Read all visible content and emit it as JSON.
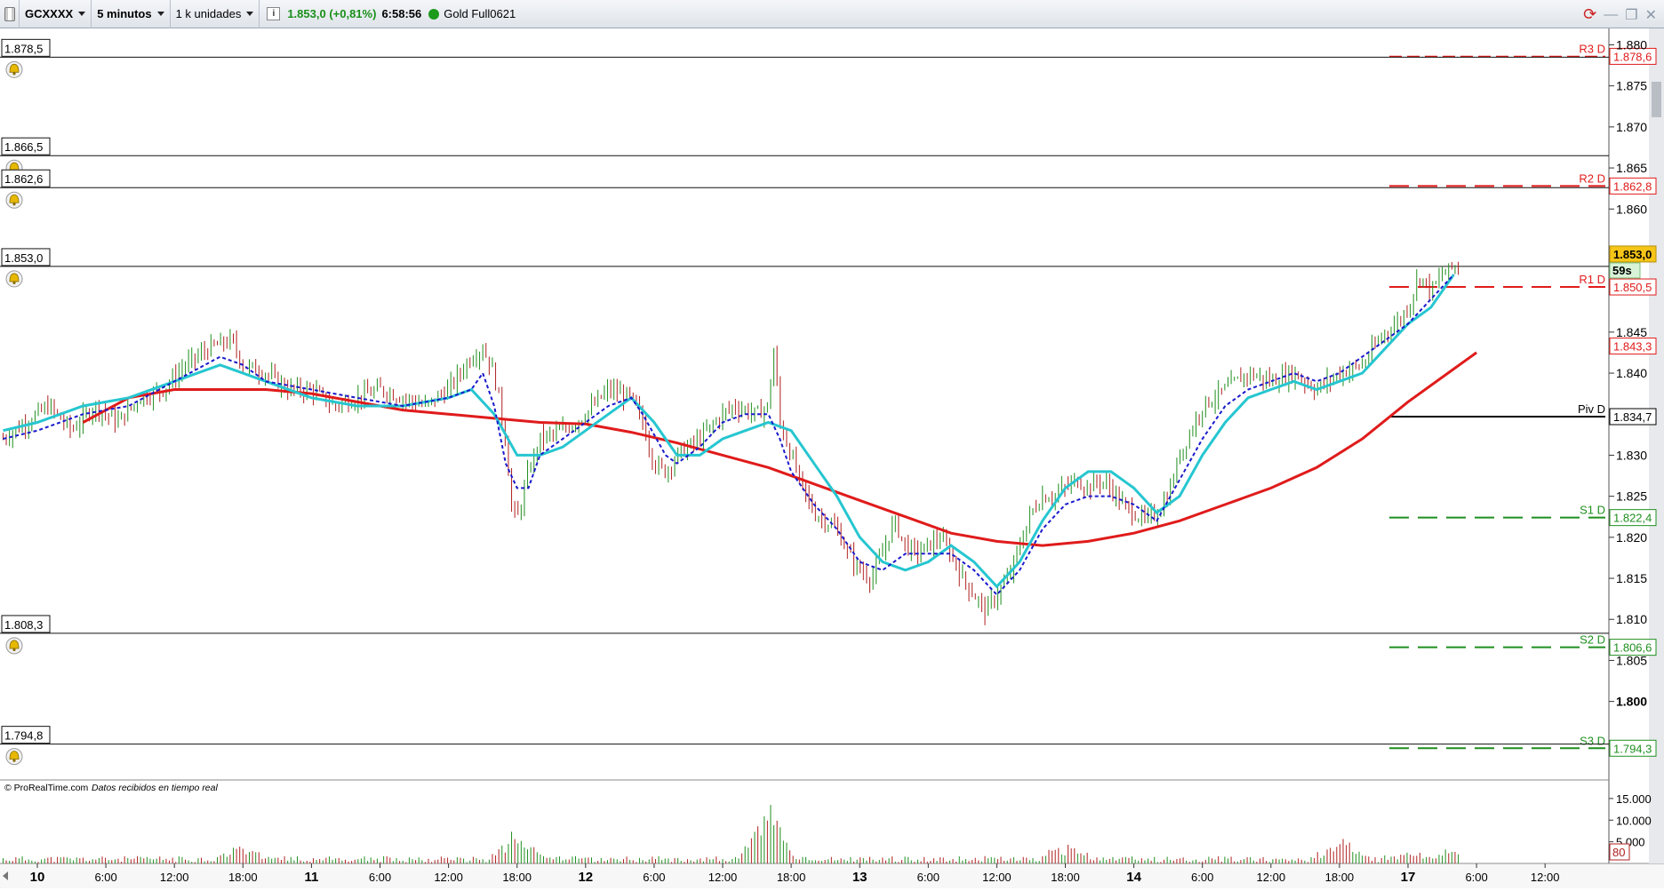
{
  "toolbar": {
    "symbol": "GCXXXX",
    "timeframe": "5 minutos",
    "units": "1 k unidades",
    "info_icon": "info-icon",
    "price_change": "1.853,0 (+0,81%)",
    "time": "6:58:56",
    "status_color": "#1c9a1c",
    "instrument": "Gold Full0621"
  },
  "colors": {
    "price_up": "#1f8f1f",
    "price_down": "#b02020",
    "ma_slow": "#e01b1b",
    "ma_fast": "#26c6d0",
    "ma_dashed": "#1a1acc",
    "resistance": "#e01b1b",
    "support": "#1f8f1f",
    "pivot": "#000000",
    "current_price_bg": "#f5c518"
  },
  "watermark": {
    "brand": "© ProRealTime.com",
    "feed": "Datos recibidos en tiempo real"
  },
  "alert_lines": [
    {
      "value": 1878.5,
      "label": "1.878,5"
    },
    {
      "value": 1866.5,
      "label": "1.866,5"
    },
    {
      "value": 1862.6,
      "label": "1.862,6"
    },
    {
      "value": 1853.0,
      "label": "1.853,0"
    },
    {
      "value": 1808.3,
      "label": "1.808,3"
    },
    {
      "value": 1794.8,
      "label": "1.794,8"
    }
  ],
  "pivot_levels": [
    {
      "name": "R3 D",
      "value": 1878.6,
      "label": "1.878,6",
      "kind": "resistance"
    },
    {
      "name": "R2 D",
      "value": 1862.8,
      "label": "1.862,8",
      "kind": "resistance"
    },
    {
      "name": "R1 D",
      "value": 1850.5,
      "label": "1.850,5",
      "kind": "resistance"
    },
    {
      "name": "Piv D",
      "value": 1834.7,
      "label": "1.834,7",
      "kind": "pivot"
    },
    {
      "name": "S1 D",
      "value": 1822.4,
      "label": "1.822,4",
      "kind": "support"
    },
    {
      "name": "S2 D",
      "value": 1806.6,
      "label": "1.806,6",
      "kind": "support"
    },
    {
      "name": "S3 D",
      "value": 1794.3,
      "label": "1.794,3",
      "kind": "support"
    }
  ],
  "price_markers": {
    "current": {
      "value": 1853.0,
      "label": "1.853,0"
    },
    "countdown": "59s",
    "ma_slow_value": {
      "value": 1843.3,
      "label": "1.843,3"
    }
  },
  "volume_axis": {
    "ticks": [
      {
        "value": 15000,
        "label": "15.000"
      },
      {
        "value": 10000,
        "label": "10.000"
      },
      {
        "value": 5000,
        "label": "5.000"
      }
    ],
    "current": "80"
  },
  "chart_data": {
    "type": "candlestick",
    "ylim": [
      1790,
      1882
    ],
    "y_ticks": [
      {
        "value": 1880,
        "label": "1.880"
      },
      {
        "value": 1875,
        "label": "1.875"
      },
      {
        "value": 1870,
        "label": "1.870"
      },
      {
        "value": 1865,
        "label": "1.865"
      },
      {
        "value": 1860,
        "label": "1.860"
      },
      {
        "value": 1845,
        "label": "1.845"
      },
      {
        "value": 1840,
        "label": "1.840"
      },
      {
        "value": 1830,
        "label": "1.830"
      },
      {
        "value": 1825,
        "label": "1.825"
      },
      {
        "value": 1820,
        "label": "1.820"
      },
      {
        "value": 1815,
        "label": "1.815"
      },
      {
        "value": 1810,
        "label": "1.810"
      },
      {
        "value": 1805,
        "label": "1.805"
      },
      {
        "value": 1800,
        "label": "1.800",
        "bold": true
      }
    ],
    "x_ticks": [
      {
        "t": 0,
        "label": "10",
        "bold": true
      },
      {
        "t": 6,
        "label": "6:00"
      },
      {
        "t": 12,
        "label": "12:00"
      },
      {
        "t": 18,
        "label": "18:00"
      },
      {
        "t": 24,
        "label": "11",
        "bold": true
      },
      {
        "t": 30,
        "label": "6:00"
      },
      {
        "t": 36,
        "label": "12:00"
      },
      {
        "t": 42,
        "label": "18:00"
      },
      {
        "t": 48,
        "label": "12",
        "bold": true
      },
      {
        "t": 54,
        "label": "6:00"
      },
      {
        "t": 60,
        "label": "12:00"
      },
      {
        "t": 66,
        "label": "18:00"
      },
      {
        "t": 72,
        "label": "13",
        "bold": true
      },
      {
        "t": 78,
        "label": "6:00"
      },
      {
        "t": 84,
        "label": "12:00"
      },
      {
        "t": 90,
        "label": "18:00"
      },
      {
        "t": 96,
        "label": "14",
        "bold": true
      },
      {
        "t": 102,
        "label": "6:00"
      },
      {
        "t": 108,
        "label": "12:00"
      },
      {
        "t": 114,
        "label": "18:00"
      },
      {
        "t": 120,
        "label": "17",
        "bold": true
      },
      {
        "t": 126,
        "label": "6:00"
      },
      {
        "t": 132,
        "label": "12:00"
      }
    ],
    "close_path": [
      [
        -3,
        1832
      ],
      [
        -1,
        1834
      ],
      [
        1,
        1836
      ],
      [
        3,
        1833
      ],
      [
        5,
        1836
      ],
      [
        7,
        1834
      ],
      [
        9,
        1837
      ],
      [
        11,
        1838
      ],
      [
        13,
        1841
      ],
      [
        15,
        1843
      ],
      [
        17,
        1844
      ],
      [
        18,
        1841
      ],
      [
        20,
        1840
      ],
      [
        22,
        1838
      ],
      [
        24,
        1838
      ],
      [
        26,
        1836
      ],
      [
        28,
        1837
      ],
      [
        30,
        1838
      ],
      [
        32,
        1837
      ],
      [
        34,
        1836
      ],
      [
        36,
        1838
      ],
      [
        37,
        1840
      ],
      [
        38,
        1842
      ],
      [
        39,
        1843
      ],
      [
        40,
        1840
      ],
      [
        41,
        1832
      ],
      [
        41.5,
        1824
      ],
      [
        42,
        1822
      ],
      [
        43,
        1828
      ],
      [
        44,
        1832
      ],
      [
        46,
        1833
      ],
      [
        48,
        1835
      ],
      [
        50,
        1838
      ],
      [
        52,
        1837
      ],
      [
        53,
        1834
      ],
      [
        54,
        1829
      ],
      [
        55,
        1828
      ],
      [
        56,
        1830
      ],
      [
        58,
        1832
      ],
      [
        60,
        1835
      ],
      [
        61,
        1836
      ],
      [
        63,
        1835
      ],
      [
        64,
        1836
      ],
      [
        64.5,
        1843
      ],
      [
        65,
        1834
      ],
      [
        66,
        1830
      ],
      [
        67,
        1826
      ],
      [
        68,
        1823
      ],
      [
        70,
        1821
      ],
      [
        71,
        1818
      ],
      [
        72,
        1816
      ],
      [
        73,
        1815
      ],
      [
        74,
        1818
      ],
      [
        75,
        1822
      ],
      [
        76,
        1819
      ],
      [
        77,
        1818
      ],
      [
        78,
        1819
      ],
      [
        79,
        1820
      ],
      [
        80,
        1818
      ],
      [
        81,
        1815
      ],
      [
        82,
        1813
      ],
      [
        83,
        1811
      ],
      [
        84,
        1813
      ],
      [
        85,
        1815
      ],
      [
        86,
        1819
      ],
      [
        87,
        1823
      ],
      [
        88,
        1825
      ],
      [
        89,
        1825
      ],
      [
        90,
        1826
      ],
      [
        91,
        1827
      ],
      [
        92,
        1826
      ],
      [
        93,
        1827
      ],
      [
        94,
        1826
      ],
      [
        95,
        1824
      ],
      [
        96,
        1823
      ],
      [
        97,
        1822
      ],
      [
        98,
        1823
      ],
      [
        99,
        1825
      ],
      [
        100,
        1830
      ],
      [
        101,
        1833
      ],
      [
        102,
        1836
      ],
      [
        104,
        1838
      ],
      [
        106,
        1840
      ],
      [
        108,
        1839
      ],
      [
        110,
        1840
      ],
      [
        112,
        1838
      ],
      [
        114,
        1840
      ],
      [
        116,
        1841
      ],
      [
        117,
        1843
      ],
      [
        118,
        1845
      ],
      [
        119,
        1846
      ],
      [
        120,
        1848
      ],
      [
        121,
        1852
      ],
      [
        122,
        1850
      ],
      [
        123,
        1852
      ],
      [
        124,
        1853
      ]
    ],
    "series": [
      {
        "name": "ma_slow",
        "style": "solid",
        "points": [
          [
            4,
            1834
          ],
          [
            8,
            1837
          ],
          [
            12,
            1838
          ],
          [
            16,
            1838
          ],
          [
            20,
            1838
          ],
          [
            24,
            1837.5
          ],
          [
            28,
            1836.5
          ],
          [
            32,
            1835.5
          ],
          [
            36,
            1835
          ],
          [
            40,
            1834.5
          ],
          [
            44,
            1834
          ],
          [
            48,
            1833.8
          ],
          [
            52,
            1832.8
          ],
          [
            56,
            1831.5
          ],
          [
            60,
            1830
          ],
          [
            64,
            1828.5
          ],
          [
            68,
            1826.5
          ],
          [
            72,
            1824.5
          ],
          [
            76,
            1822.5
          ],
          [
            80,
            1820.5
          ],
          [
            84,
            1819.5
          ],
          [
            88,
            1819
          ],
          [
            92,
            1819.5
          ],
          [
            96,
            1820.5
          ],
          [
            100,
            1822
          ],
          [
            104,
            1824
          ],
          [
            108,
            1826
          ],
          [
            112,
            1828.5
          ],
          [
            116,
            1832
          ],
          [
            120,
            1836.5
          ],
          [
            124,
            1840.5
          ],
          [
            126,
            1842.5
          ]
        ]
      },
      {
        "name": "ma_fast",
        "style": "solid",
        "points": [
          [
            -3,
            1833
          ],
          [
            0,
            1834
          ],
          [
            4,
            1836
          ],
          [
            8,
            1837
          ],
          [
            12,
            1839
          ],
          [
            16,
            1841
          ],
          [
            20,
            1839
          ],
          [
            24,
            1837
          ],
          [
            28,
            1836
          ],
          [
            32,
            1836
          ],
          [
            36,
            1837
          ],
          [
            38,
            1838
          ],
          [
            40,
            1835
          ],
          [
            42,
            1830
          ],
          [
            44,
            1830
          ],
          [
            46,
            1831
          ],
          [
            48,
            1833
          ],
          [
            50,
            1835
          ],
          [
            52,
            1837
          ],
          [
            54,
            1834
          ],
          [
            56,
            1830
          ],
          [
            58,
            1830
          ],
          [
            60,
            1832
          ],
          [
            62,
            1833
          ],
          [
            64,
            1834
          ],
          [
            66,
            1833
          ],
          [
            68,
            1829
          ],
          [
            70,
            1825
          ],
          [
            72,
            1820
          ],
          [
            74,
            1817
          ],
          [
            76,
            1816
          ],
          [
            78,
            1817
          ],
          [
            80,
            1819
          ],
          [
            82,
            1817
          ],
          [
            84,
            1814
          ],
          [
            86,
            1817
          ],
          [
            88,
            1822
          ],
          [
            90,
            1826
          ],
          [
            92,
            1828
          ],
          [
            94,
            1828
          ],
          [
            96,
            1826
          ],
          [
            98,
            1823
          ],
          [
            100,
            1825
          ],
          [
            102,
            1830
          ],
          [
            104,
            1834
          ],
          [
            106,
            1837
          ],
          [
            108,
            1838
          ],
          [
            110,
            1839
          ],
          [
            112,
            1838
          ],
          [
            114,
            1839
          ],
          [
            116,
            1840
          ],
          [
            118,
            1843
          ],
          [
            120,
            1846
          ],
          [
            122,
            1848
          ],
          [
            124,
            1852
          ]
        ]
      },
      {
        "name": "ma_dashed",
        "style": "dashed",
        "points": [
          [
            -3,
            1832
          ],
          [
            0,
            1833
          ],
          [
            4,
            1835
          ],
          [
            8,
            1836
          ],
          [
            12,
            1839
          ],
          [
            16,
            1842
          ],
          [
            18,
            1841
          ],
          [
            20,
            1839
          ],
          [
            24,
            1838
          ],
          [
            28,
            1837
          ],
          [
            32,
            1836
          ],
          [
            36,
            1837
          ],
          [
            38,
            1838
          ],
          [
            39,
            1840
          ],
          [
            40,
            1836
          ],
          [
            41,
            1829
          ],
          [
            42,
            1826
          ],
          [
            43,
            1826
          ],
          [
            44,
            1830
          ],
          [
            46,
            1832
          ],
          [
            48,
            1834
          ],
          [
            50,
            1836
          ],
          [
            52,
            1837
          ],
          [
            53,
            1835
          ],
          [
            55,
            1830
          ],
          [
            56,
            1829
          ],
          [
            58,
            1831
          ],
          [
            60,
            1834
          ],
          [
            62,
            1835
          ],
          [
            64,
            1835
          ],
          [
            65,
            1832
          ],
          [
            66,
            1828
          ],
          [
            68,
            1824
          ],
          [
            70,
            1821
          ],
          [
            72,
            1817
          ],
          [
            74,
            1816
          ],
          [
            76,
            1818
          ],
          [
            78,
            1818
          ],
          [
            80,
            1818
          ],
          [
            82,
            1816
          ],
          [
            84,
            1813
          ],
          [
            86,
            1816
          ],
          [
            88,
            1821
          ],
          [
            90,
            1824
          ],
          [
            92,
            1825
          ],
          [
            94,
            1825
          ],
          [
            96,
            1824
          ],
          [
            98,
            1822
          ],
          [
            100,
            1827
          ],
          [
            102,
            1832
          ],
          [
            104,
            1836
          ],
          [
            106,
            1838
          ],
          [
            108,
            1839
          ],
          [
            110,
            1840
          ],
          [
            112,
            1839
          ],
          [
            114,
            1840
          ],
          [
            116,
            1842
          ],
          [
            118,
            1844
          ],
          [
            120,
            1846
          ],
          [
            122,
            1849
          ],
          [
            124,
            1852
          ]
        ]
      }
    ],
    "volume_ylim": [
      0,
      16000
    ],
    "volume_spikes": [
      [
        18,
        3500
      ],
      [
        42,
        7500
      ],
      [
        64,
        15000
      ],
      [
        90,
        3800
      ],
      [
        114,
        5000
      ],
      [
        120,
        2000
      ],
      [
        124,
        2500
      ]
    ]
  }
}
